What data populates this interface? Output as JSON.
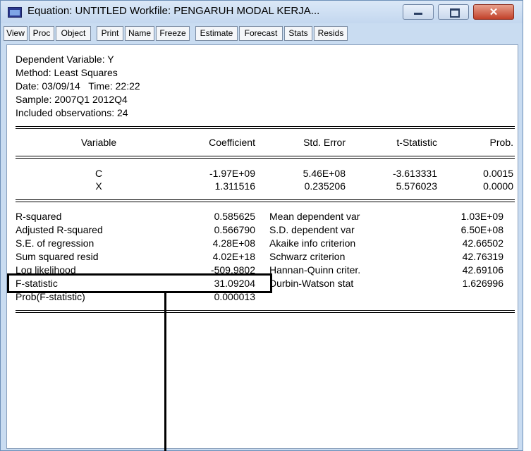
{
  "window": {
    "title": "Equation: UNTITLED   Workfile: PENGARUH MODAL KERJA...",
    "close_glyph": "✕"
  },
  "toolbar": [
    "View",
    "Proc",
    "Object",
    "Print",
    "Name",
    "Freeze",
    "Estimate",
    "Forecast",
    "Stats",
    "Resids"
  ],
  "header": {
    "dep_var": "Dependent Variable: Y",
    "method": "Method: Least Squares",
    "date": "Date: 03/09/14   Time: 22:22",
    "sample": "Sample: 2007Q1 2012Q4",
    "obs": "Included observations: 24"
  },
  "table": {
    "headers": [
      "Variable",
      "Coefficient",
      "Std. Error",
      "t-Statistic",
      "Prob."
    ],
    "rows": [
      [
        "C",
        "-1.97E+09",
        "5.46E+08",
        "-3.613331",
        "0.0015"
      ],
      [
        "X",
        "1.311516",
        "0.235206",
        "5.576023",
        "0.0000"
      ]
    ]
  },
  "stats": {
    "left": [
      [
        "R-squared",
        "0.585625"
      ],
      [
        "Adjusted R-squared",
        "0.566790"
      ],
      [
        "S.E. of regression",
        "4.28E+08"
      ],
      [
        "Sum squared resid",
        "4.02E+18"
      ],
      [
        "Log likelihood",
        "-509.9802"
      ],
      [
        "F-statistic",
        "31.09204"
      ],
      [
        "Prob(F-statistic)",
        "0.000013"
      ]
    ],
    "right": [
      [
        "Mean dependent var",
        "1.03E+09"
      ],
      [
        "S.D. dependent var",
        "6.50E+08"
      ],
      [
        "Akaike info criterion",
        "42.66502"
      ],
      [
        "Schwarz criterion",
        "42.76319"
      ],
      [
        "Hannan-Quinn criter.",
        "42.69106"
      ],
      [
        "Durbin-Watson stat",
        "1.626996"
      ]
    ]
  }
}
